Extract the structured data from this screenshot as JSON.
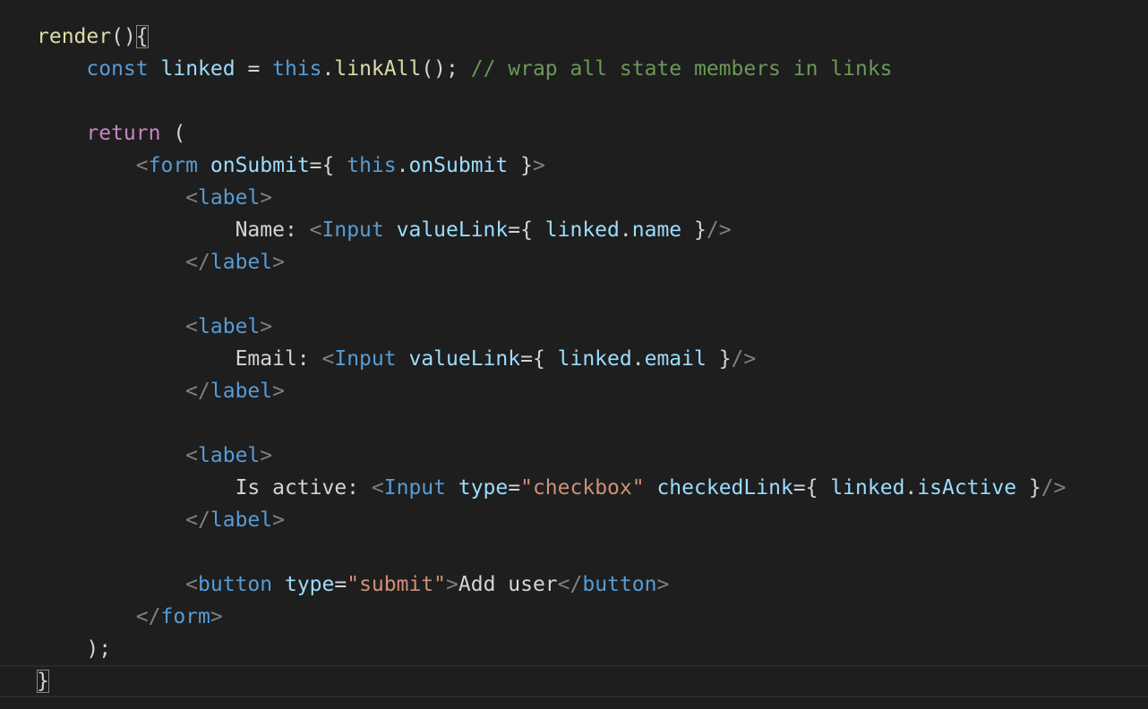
{
  "editor": {
    "language": "javascript-jsx",
    "theme_colors": {
      "background": "#1e1e1e",
      "function": "#dcdcaa",
      "keyword": "#569cd6",
      "control": "#c586c0",
      "variable": "#9cdcfe",
      "comment": "#6a9955",
      "tag_punctuation": "#808080",
      "string": "#ce9178",
      "text": "#d4d4d4"
    },
    "lines": [
      [
        {
          "t": "render",
          "c": "fn"
        },
        {
          "t": "()",
          "c": "punc"
        },
        {
          "t": "{",
          "c": "punc",
          "m": true
        }
      ],
      [
        {
          "t": "    ",
          "c": "punc"
        },
        {
          "t": "const",
          "c": "kw"
        },
        {
          "t": " ",
          "c": "punc"
        },
        {
          "t": "linked",
          "c": "var"
        },
        {
          "t": " = ",
          "c": "punc"
        },
        {
          "t": "this",
          "c": "this"
        },
        {
          "t": ".",
          "c": "punc"
        },
        {
          "t": "linkAll",
          "c": "fn"
        },
        {
          "t": "(); ",
          "c": "punc"
        },
        {
          "t": "// wrap all state members in links",
          "c": "cm"
        }
      ],
      [],
      [
        {
          "t": "    ",
          "c": "punc"
        },
        {
          "t": "return",
          "c": "ctl"
        },
        {
          "t": " (",
          "c": "punc"
        }
      ],
      [
        {
          "t": "        ",
          "c": "punc"
        },
        {
          "t": "<",
          "c": "tagp"
        },
        {
          "t": "form",
          "c": "tag"
        },
        {
          "t": " ",
          "c": "punc"
        },
        {
          "t": "onSubmit",
          "c": "attr"
        },
        {
          "t": "={ ",
          "c": "punc"
        },
        {
          "t": "this",
          "c": "this"
        },
        {
          "t": ".",
          "c": "punc"
        },
        {
          "t": "onSubmit",
          "c": "var"
        },
        {
          "t": " }",
          "c": "punc"
        },
        {
          "t": ">",
          "c": "tagp"
        }
      ],
      [
        {
          "t": "            ",
          "c": "punc"
        },
        {
          "t": "<",
          "c": "tagp"
        },
        {
          "t": "label",
          "c": "tag"
        },
        {
          "t": ">",
          "c": "tagp"
        }
      ],
      [
        {
          "t": "                ",
          "c": "punc"
        },
        {
          "t": "Name: ",
          "c": "txt"
        },
        {
          "t": "<",
          "c": "tagp"
        },
        {
          "t": "Input",
          "c": "tag"
        },
        {
          "t": " ",
          "c": "punc"
        },
        {
          "t": "valueLink",
          "c": "attr"
        },
        {
          "t": "={ ",
          "c": "punc"
        },
        {
          "t": "linked",
          "c": "var"
        },
        {
          "t": ".",
          "c": "punc"
        },
        {
          "t": "name",
          "c": "var"
        },
        {
          "t": " }",
          "c": "punc"
        },
        {
          "t": "/>",
          "c": "tagp"
        }
      ],
      [
        {
          "t": "            ",
          "c": "punc"
        },
        {
          "t": "</",
          "c": "tagp"
        },
        {
          "t": "label",
          "c": "tag"
        },
        {
          "t": ">",
          "c": "tagp"
        }
      ],
      [],
      [
        {
          "t": "            ",
          "c": "punc"
        },
        {
          "t": "<",
          "c": "tagp"
        },
        {
          "t": "label",
          "c": "tag"
        },
        {
          "t": ">",
          "c": "tagp"
        }
      ],
      [
        {
          "t": "                ",
          "c": "punc"
        },
        {
          "t": "Email: ",
          "c": "txt"
        },
        {
          "t": "<",
          "c": "tagp"
        },
        {
          "t": "Input",
          "c": "tag"
        },
        {
          "t": " ",
          "c": "punc"
        },
        {
          "t": "valueLink",
          "c": "attr"
        },
        {
          "t": "={ ",
          "c": "punc"
        },
        {
          "t": "linked",
          "c": "var"
        },
        {
          "t": ".",
          "c": "punc"
        },
        {
          "t": "email",
          "c": "var"
        },
        {
          "t": " }",
          "c": "punc"
        },
        {
          "t": "/>",
          "c": "tagp"
        }
      ],
      [
        {
          "t": "            ",
          "c": "punc"
        },
        {
          "t": "</",
          "c": "tagp"
        },
        {
          "t": "label",
          "c": "tag"
        },
        {
          "t": ">",
          "c": "tagp"
        }
      ],
      [],
      [
        {
          "t": "            ",
          "c": "punc"
        },
        {
          "t": "<",
          "c": "tagp"
        },
        {
          "t": "label",
          "c": "tag"
        },
        {
          "t": ">",
          "c": "tagp"
        }
      ],
      [
        {
          "t": "                ",
          "c": "punc"
        },
        {
          "t": "Is active: ",
          "c": "txt"
        },
        {
          "t": "<",
          "c": "tagp"
        },
        {
          "t": "Input",
          "c": "tag"
        },
        {
          "t": " ",
          "c": "punc"
        },
        {
          "t": "type",
          "c": "attr"
        },
        {
          "t": "=",
          "c": "punc"
        },
        {
          "t": "\"checkbox\"",
          "c": "str"
        },
        {
          "t": " ",
          "c": "punc"
        },
        {
          "t": "checkedLink",
          "c": "attr"
        },
        {
          "t": "={ ",
          "c": "punc"
        },
        {
          "t": "linked",
          "c": "var"
        },
        {
          "t": ".",
          "c": "punc"
        },
        {
          "t": "isActive",
          "c": "var"
        },
        {
          "t": " }",
          "c": "punc"
        },
        {
          "t": "/>",
          "c": "tagp"
        }
      ],
      [
        {
          "t": "            ",
          "c": "punc"
        },
        {
          "t": "</",
          "c": "tagp"
        },
        {
          "t": "label",
          "c": "tag"
        },
        {
          "t": ">",
          "c": "tagp"
        }
      ],
      [],
      [
        {
          "t": "            ",
          "c": "punc"
        },
        {
          "t": "<",
          "c": "tagp"
        },
        {
          "t": "button",
          "c": "tag"
        },
        {
          "t": " ",
          "c": "punc"
        },
        {
          "t": "type",
          "c": "attr"
        },
        {
          "t": "=",
          "c": "punc"
        },
        {
          "t": "\"submit\"",
          "c": "str"
        },
        {
          "t": ">",
          "c": "tagp"
        },
        {
          "t": "Add user",
          "c": "txt"
        },
        {
          "t": "</",
          "c": "tagp"
        },
        {
          "t": "button",
          "c": "tag"
        },
        {
          "t": ">",
          "c": "tagp"
        }
      ],
      [
        {
          "t": "        ",
          "c": "punc"
        },
        {
          "t": "</",
          "c": "tagp"
        },
        {
          "t": "form",
          "c": "tag"
        },
        {
          "t": ">",
          "c": "tagp"
        }
      ],
      [
        {
          "t": "    ",
          "c": "punc"
        },
        {
          "t": ");",
          "c": "punc"
        }
      ],
      [
        {
          "t": "}",
          "c": "punc",
          "m": true
        }
      ]
    ]
  }
}
